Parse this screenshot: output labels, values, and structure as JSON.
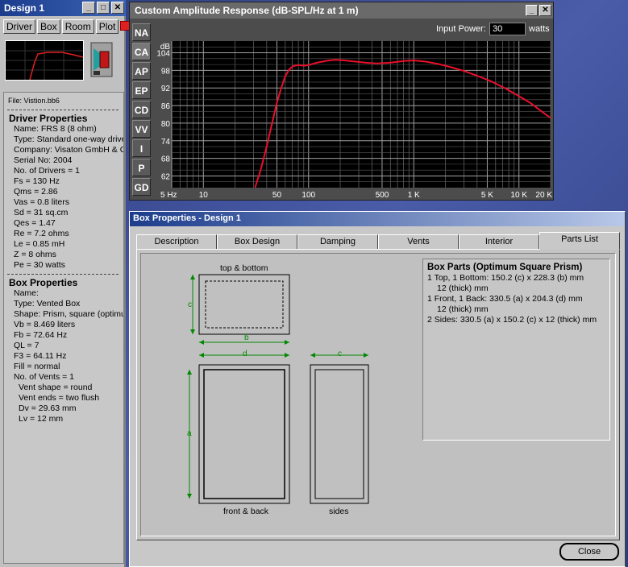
{
  "left_panel": {
    "title": "Design 1",
    "title_buttons": [
      "_",
      "□",
      "✕"
    ],
    "buttons": [
      "Driver",
      "Box",
      "Room",
      "Plot"
    ],
    "file": "File: Vistion.bb6",
    "driver_heading": "Driver Properties",
    "driver_props": [
      "Name: FRS 8  (8 ohm)",
      "Type: Standard one-way driver",
      "Company: Visaton GmbH & Co",
      "Serial No: 2004",
      "No. of Drivers = 1",
      "Fs  =  130 Hz",
      "Qms  =  2.86",
      "Vas  =  0.8 liters",
      "Sd  =  31 sq.cm",
      "Qes  =  1.47",
      "Re  =  7.2 ohms",
      "Le  =  0.85 mH",
      "Z  =  8 ohms",
      "Pe  =  30 watts"
    ],
    "box_heading": "Box Properties",
    "box_props": [
      {
        "text": "Name:",
        "indent": 1
      },
      {
        "text": "Type: Vented Box",
        "indent": 1
      },
      {
        "text": "Shape: Prism, square (optimum)",
        "indent": 1
      },
      {
        "text": "Vb  =  8.469 liters",
        "indent": 1
      },
      {
        "text": "Fb  =  72.64 Hz",
        "indent": 1
      },
      {
        "text": "QL  =  7",
        "indent": 1
      },
      {
        "text": "F3  =  64.11 Hz",
        "indent": 1
      },
      {
        "text": "Fill = normal",
        "indent": 1
      },
      {
        "text": "No. of Vents = 1",
        "indent": 1
      },
      {
        "text": "Vent shape = round",
        "indent": 2
      },
      {
        "text": "Vent ends = two flush",
        "indent": 2
      },
      {
        "text": "Dv  =  29.63 mm",
        "indent": 2
      },
      {
        "text": "Lv  =  12 mm",
        "indent": 2
      }
    ]
  },
  "chart_window": {
    "title": "Custom Amplitude Response  (dB-SPL/Hz at 1 m)",
    "side_tabs": [
      "NA",
      "CA",
      "AP",
      "EP",
      "CD",
      "VV",
      "I",
      "P",
      "GD"
    ],
    "active_tab": "CA",
    "input_power_label": "Input Power:",
    "input_power_value": "30",
    "input_power_unit": "watts"
  },
  "chart_data": {
    "type": "line",
    "ylabel": "dB",
    "y_ticks": [
      104,
      98,
      92,
      86,
      80,
      74,
      68,
      62
    ],
    "x_ticks": [
      {
        "label": "5 Hz",
        "value": 5
      },
      {
        "label": "10",
        "value": 10
      },
      {
        "label": "50",
        "value": 50
      },
      {
        "label": "100",
        "value": 100
      },
      {
        "label": "500",
        "value": 500
      },
      {
        "label": "1 K",
        "value": 1000
      },
      {
        "label": "5 K",
        "value": 5000
      },
      {
        "label": "10 K",
        "value": 10000
      },
      {
        "label": "20 K",
        "value": 20000
      }
    ],
    "xlim": [
      5,
      20000
    ],
    "ylim": [
      58,
      108
    ],
    "x_scale": "log",
    "grid": true,
    "series": [
      {
        "color": "#e8102a",
        "points": [
          [
            31,
            58
          ],
          [
            35,
            64
          ],
          [
            40,
            72
          ],
          [
            45,
            80
          ],
          [
            50,
            87
          ],
          [
            55,
            92
          ],
          [
            60,
            96
          ],
          [
            66,
            98.5
          ],
          [
            72,
            99.5
          ],
          [
            80,
            99.8
          ],
          [
            90,
            99.6
          ],
          [
            100,
            99.8
          ],
          [
            120,
            100.6
          ],
          [
            150,
            101.3
          ],
          [
            180,
            101.6
          ],
          [
            220,
            101.4
          ],
          [
            280,
            101
          ],
          [
            350,
            100.6
          ],
          [
            450,
            100.4
          ],
          [
            600,
            100.6
          ],
          [
            800,
            101.2
          ],
          [
            1000,
            101.4
          ],
          [
            1300,
            101
          ],
          [
            1700,
            100.2
          ],
          [
            2200,
            99.2
          ],
          [
            3000,
            97.8
          ],
          [
            4000,
            96.2
          ],
          [
            5500,
            94.2
          ],
          [
            7500,
            91.8
          ],
          [
            10000,
            89.2
          ],
          [
            13000,
            86.8
          ],
          [
            16000,
            84.3
          ],
          [
            20000,
            81.8
          ]
        ]
      }
    ]
  },
  "box_dialog": {
    "title": "Box Properties - Design 1",
    "tabs": [
      "Description",
      "Box Design",
      "Damping",
      "Vents",
      "Interior",
      "Parts List"
    ],
    "active_tab": "Parts List",
    "drawing_labels": {
      "top_bottom": "top & bottom",
      "front_back": "front & back",
      "sides": "sides",
      "dim_a": "a",
      "dim_b": "b",
      "dim_c": "c",
      "dim_d": "d"
    },
    "parts_heading": "Box Parts (Optimum Square Prism)",
    "parts": [
      {
        "text": "1 Top, 1 Bottom:  150.2 (c) x 228.3 (b) mm",
        "indent": false
      },
      {
        "text": "12 (thick) mm",
        "indent": true
      },
      {
        "text": "1 Front, 1 Back:  330.5 (a) x 204.3 (d) mm",
        "indent": false
      },
      {
        "text": "12 (thick) mm",
        "indent": true
      },
      {
        "text": "2 Sides:  330.5 (a) x 150.2 (c) x 12 (thick) mm",
        "indent": false
      }
    ],
    "close_label": "Close"
  }
}
